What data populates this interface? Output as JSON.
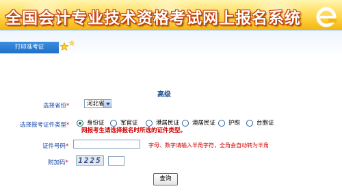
{
  "banner": {
    "title": "全国会计专业技术资格考试网上报名系统"
  },
  "nav": {
    "tab_label": "打印准考证"
  },
  "form": {
    "section_title": "高级",
    "province_label": "选择省份",
    "province_value": "河北省",
    "cert_type_label": "选择报考证件类型",
    "cert_types": [
      "身份证",
      "军官证",
      "港居民证",
      "澳居民证",
      "护照",
      "台胞证"
    ],
    "selected_cert_index": 0,
    "cert_warning": "网报考生请选择报名时所选的证件类型。",
    "id_label": "证件号码",
    "id_value": "",
    "id_hint": "字母、数字请输入半角字符，全角会自动转为半角",
    "captcha_label": "附加码",
    "captcha_text": "1225",
    "captcha_value": "",
    "required_mark": "*",
    "query_button": "查询"
  },
  "colors": {
    "label_blue": "#1a4aa8",
    "warning_red": "#d10000",
    "tab_blue": "#1e6fc8"
  }
}
